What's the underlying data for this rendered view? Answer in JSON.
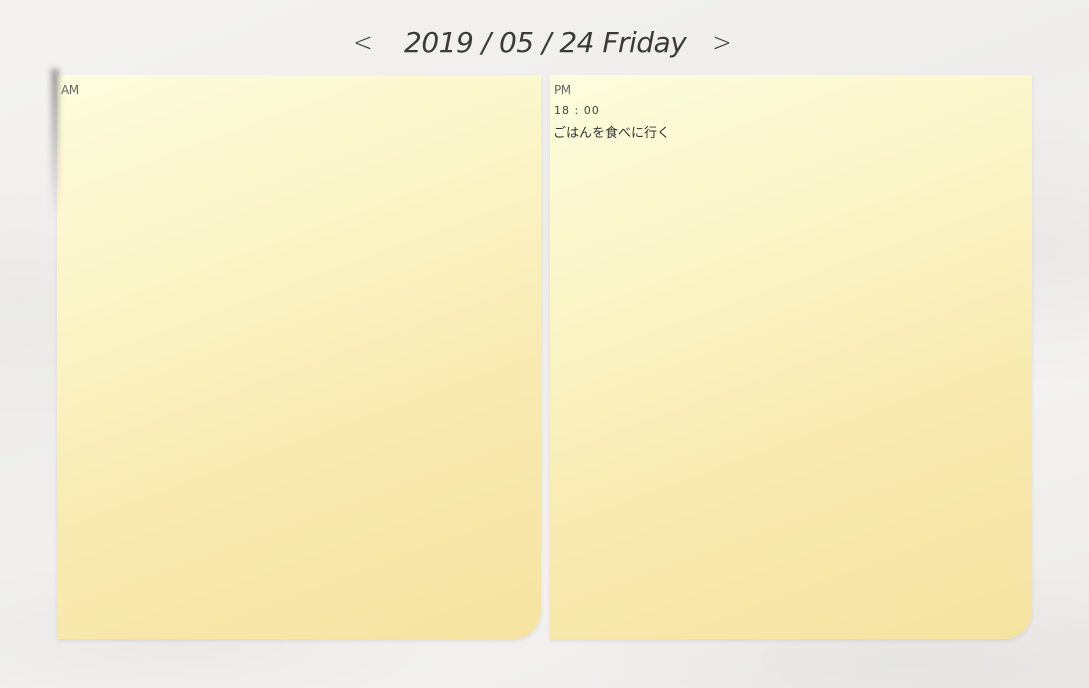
{
  "header": {
    "prev_label": "<",
    "date_label": "2019 / 05 / 24 Friday",
    "next_label": ">"
  },
  "notes": {
    "am": {
      "label": "AM",
      "entries": []
    },
    "pm": {
      "label": "PM",
      "entries": [
        {
          "time": "18 : 00",
          "text": "ごはんを食べに行く"
        }
      ]
    }
  },
  "colors": {
    "note_top": "#fdfdde",
    "note_bottom": "#f6e3a1",
    "background": "#f1f0ee",
    "text": "#3a3a3a"
  }
}
